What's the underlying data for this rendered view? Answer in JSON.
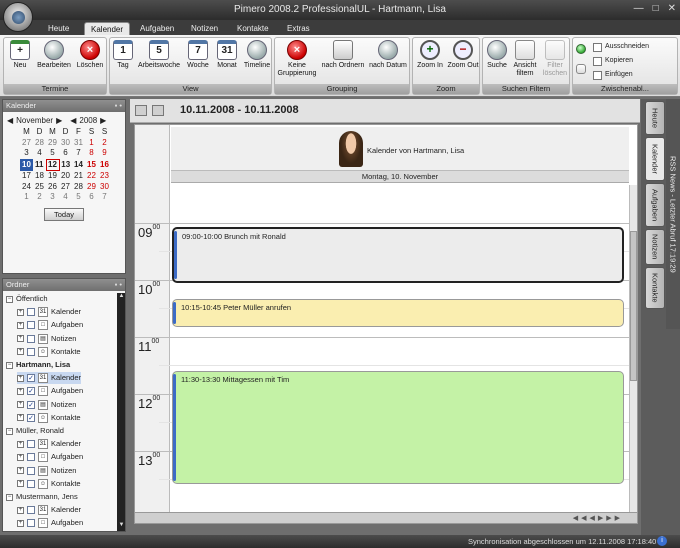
{
  "window": {
    "title": "Pimero 2008.2 ProfessionalUL - Hartmann, Lisa"
  },
  "tabs": [
    "Heute",
    "Kalender",
    "Aufgaben",
    "Notizen",
    "Kontakte",
    "Extras"
  ],
  "active_tab": "Kalender",
  "ribbon": {
    "groups": {
      "termine": "Termine",
      "view": "View",
      "grouping": "Grouping",
      "zoom": "Zoom",
      "suchen": "Suchen Filtern",
      "zwischen": "Zwischenabl..."
    },
    "buttons": {
      "neu": "Neu",
      "bearbeiten": "Bearbeiten",
      "loeschen": "Löschen",
      "tag": "Tag",
      "tag_icon": "1",
      "arbeitswoche": "Arbeitswoche",
      "arbeitswoche_icon": "5",
      "woche": "Woche",
      "woche_icon": "7",
      "monat": "Monat",
      "monat_icon": "31",
      "timeline": "Timeline",
      "keine_gruppierung_1": "Keine",
      "keine_gruppierung_2": "Gruppierung",
      "nach_ordnern": "nach Ordnern",
      "nach_datum": "nach Datum",
      "zoom_in": "Zoom In",
      "zoom_out": "Zoom Out",
      "suche": "Suche",
      "ansicht_filtern_1": "Ansicht",
      "ansicht_filtern_2": "filtern",
      "filter_loeschen_1": "Filter",
      "filter_loeschen_2": "löschen",
      "ausschneiden": "Ausschneiden",
      "kopieren": "Kopieren",
      "einfuegen": "Einfügen"
    }
  },
  "kalender_panel": {
    "title": "Kalender",
    "month": "November",
    "year": "2008",
    "weekdays": [
      "M",
      "D",
      "M",
      "D",
      "F",
      "S",
      "S"
    ],
    "weeks": [
      [
        "27",
        "28",
        "29",
        "30",
        "31",
        "1",
        "2"
      ],
      [
        "3",
        "4",
        "5",
        "6",
        "7",
        "8",
        "9"
      ],
      [
        "10",
        "11",
        "12",
        "13",
        "14",
        "15",
        "16"
      ],
      [
        "17",
        "18",
        "19",
        "20",
        "21",
        "22",
        "23"
      ],
      [
        "24",
        "25",
        "26",
        "27",
        "28",
        "29",
        "30"
      ],
      [
        "1",
        "2",
        "3",
        "4",
        "5",
        "6",
        "7"
      ]
    ],
    "today_button": "Today"
  },
  "ordner_panel": {
    "title": "Ordner",
    "rows": [
      {
        "text": "Öffentlich",
        "level": 0,
        "bold": false
      },
      {
        "text": "Kalender",
        "level": 1,
        "icon": "calendar",
        "checked": false
      },
      {
        "text": "Aufgaben",
        "level": 1,
        "icon": "task",
        "checked": false
      },
      {
        "text": "Notizen",
        "level": 1,
        "icon": "note",
        "checked": false
      },
      {
        "text": "Kontakte",
        "level": 1,
        "icon": "contact",
        "checked": false
      },
      {
        "text": "Hartmann, Lisa",
        "level": 0,
        "bold": true
      },
      {
        "text": "Kalender",
        "level": 1,
        "icon": "calendar",
        "checked": true,
        "selected": true
      },
      {
        "text": "Aufgaben",
        "level": 1,
        "icon": "task",
        "checked": true
      },
      {
        "text": "Notizen",
        "level": 1,
        "icon": "note",
        "checked": true
      },
      {
        "text": "Kontakte",
        "level": 1,
        "icon": "contact",
        "checked": true
      },
      {
        "text": "Müller, Ronald",
        "level": 0,
        "bold": false
      },
      {
        "text": "Kalender",
        "level": 1,
        "icon": "calendar",
        "checked": false
      },
      {
        "text": "Aufgaben",
        "level": 1,
        "icon": "task",
        "checked": false
      },
      {
        "text": "Notizen",
        "level": 1,
        "icon": "note",
        "checked": false
      },
      {
        "text": "Kontakte",
        "level": 1,
        "icon": "contact",
        "checked": false
      },
      {
        "text": "Mustermann, Jens",
        "level": 0,
        "bold": false
      },
      {
        "text": "Kalender",
        "level": 1,
        "icon": "calendar",
        "checked": false
      },
      {
        "text": "Aufgaben",
        "level": 1,
        "icon": "task",
        "checked": false
      }
    ]
  },
  "calendar": {
    "date_range": "10.11.2008 - 10.11.2008",
    "owner_label": "Kalender von Hartmann, Lisa",
    "day_header": "Montag, 10. November",
    "hours": [
      {
        "h": "09",
        "m": "00"
      },
      {
        "h": "10",
        "m": "00"
      },
      {
        "h": "11",
        "m": "00"
      },
      {
        "h": "12",
        "m": "00"
      },
      {
        "h": "13",
        "m": "00"
      }
    ],
    "appointments": [
      {
        "text": "09:00-10:00 Brunch mit Ronald",
        "color": "#ececec",
        "selected": true
      },
      {
        "text": "10:15-10:45 Peter Müller anrufen",
        "color": "#faeeb0"
      },
      {
        "text": "11:30-13:30 Mittagessen mit Tim",
        "color": "#c4f2a6"
      }
    ]
  },
  "right_tabs": [
    "Heute",
    "Kalender",
    "Aufgaben",
    "Notizen",
    "Kontakte"
  ],
  "rss_label": "RSS News - Letzter Abruf 17:19:29",
  "status": {
    "text": "Synchronisation abgeschlossen um 12.11.2008 17:18:40"
  }
}
